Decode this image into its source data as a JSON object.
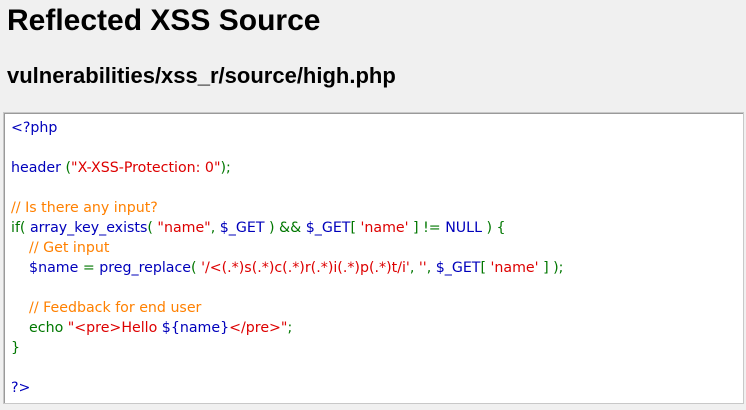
{
  "header": {
    "title": "Reflected XSS Source",
    "file_path": "vulnerabilities/xss_r/source/high.php"
  },
  "colors": {
    "default": "#0000bb",
    "keyword": "#007700",
    "string": "#dd0000",
    "comment": "#ff8000"
  },
  "code_lines": [
    [
      {
        "t": "<?php",
        "c": "default"
      }
    ],
    [],
    [
      {
        "t": "header ",
        "c": "default"
      },
      {
        "t": "(",
        "c": "keyword"
      },
      {
        "t": "\"X-XSS-Protection: 0\"",
        "c": "string"
      },
      {
        "t": ");",
        "c": "keyword"
      }
    ],
    [],
    [
      {
        "t": "// Is there any input?",
        "c": "comment"
      }
    ],
    [
      {
        "t": "if( ",
        "c": "keyword"
      },
      {
        "t": "array_key_exists",
        "c": "default"
      },
      {
        "t": "( ",
        "c": "keyword"
      },
      {
        "t": "\"name\"",
        "c": "string"
      },
      {
        "t": ", ",
        "c": "keyword"
      },
      {
        "t": "$_GET ",
        "c": "default"
      },
      {
        "t": ") && ",
        "c": "keyword"
      },
      {
        "t": "$_GET",
        "c": "default"
      },
      {
        "t": "[ ",
        "c": "keyword"
      },
      {
        "t": "'name' ",
        "c": "string"
      },
      {
        "t": "] != ",
        "c": "keyword"
      },
      {
        "t": "NULL ",
        "c": "default"
      },
      {
        "t": ") {",
        "c": "keyword"
      }
    ],
    [
      {
        "t": "    ",
        "c": "default"
      },
      {
        "t": "// Get input",
        "c": "comment"
      }
    ],
    [
      {
        "t": "    ",
        "c": "default"
      },
      {
        "t": "$name ",
        "c": "default"
      },
      {
        "t": "= ",
        "c": "keyword"
      },
      {
        "t": "preg_replace",
        "c": "default"
      },
      {
        "t": "( ",
        "c": "keyword"
      },
      {
        "t": "'/<(.*)s(.*)c(.*)r(.*)i(.*)p(.*)t/i'",
        "c": "string"
      },
      {
        "t": ", ",
        "c": "keyword"
      },
      {
        "t": "''",
        "c": "string"
      },
      {
        "t": ", ",
        "c": "keyword"
      },
      {
        "t": "$_GET",
        "c": "default"
      },
      {
        "t": "[ ",
        "c": "keyword"
      },
      {
        "t": "'name' ",
        "c": "string"
      },
      {
        "t": "] );",
        "c": "keyword"
      }
    ],
    [],
    [
      {
        "t": "    ",
        "c": "default"
      },
      {
        "t": "// Feedback for end user",
        "c": "comment"
      }
    ],
    [
      {
        "t": "    ",
        "c": "default"
      },
      {
        "t": "echo ",
        "c": "keyword"
      },
      {
        "t": "\"<pre>Hello ",
        "c": "string"
      },
      {
        "t": "${name}",
        "c": "default"
      },
      {
        "t": "</pre>\"",
        "c": "string"
      },
      {
        "t": ";",
        "c": "keyword"
      }
    ],
    [
      {
        "t": "}",
        "c": "keyword"
      }
    ],
    [],
    [
      {
        "t": "?>",
        "c": "default"
      }
    ]
  ]
}
